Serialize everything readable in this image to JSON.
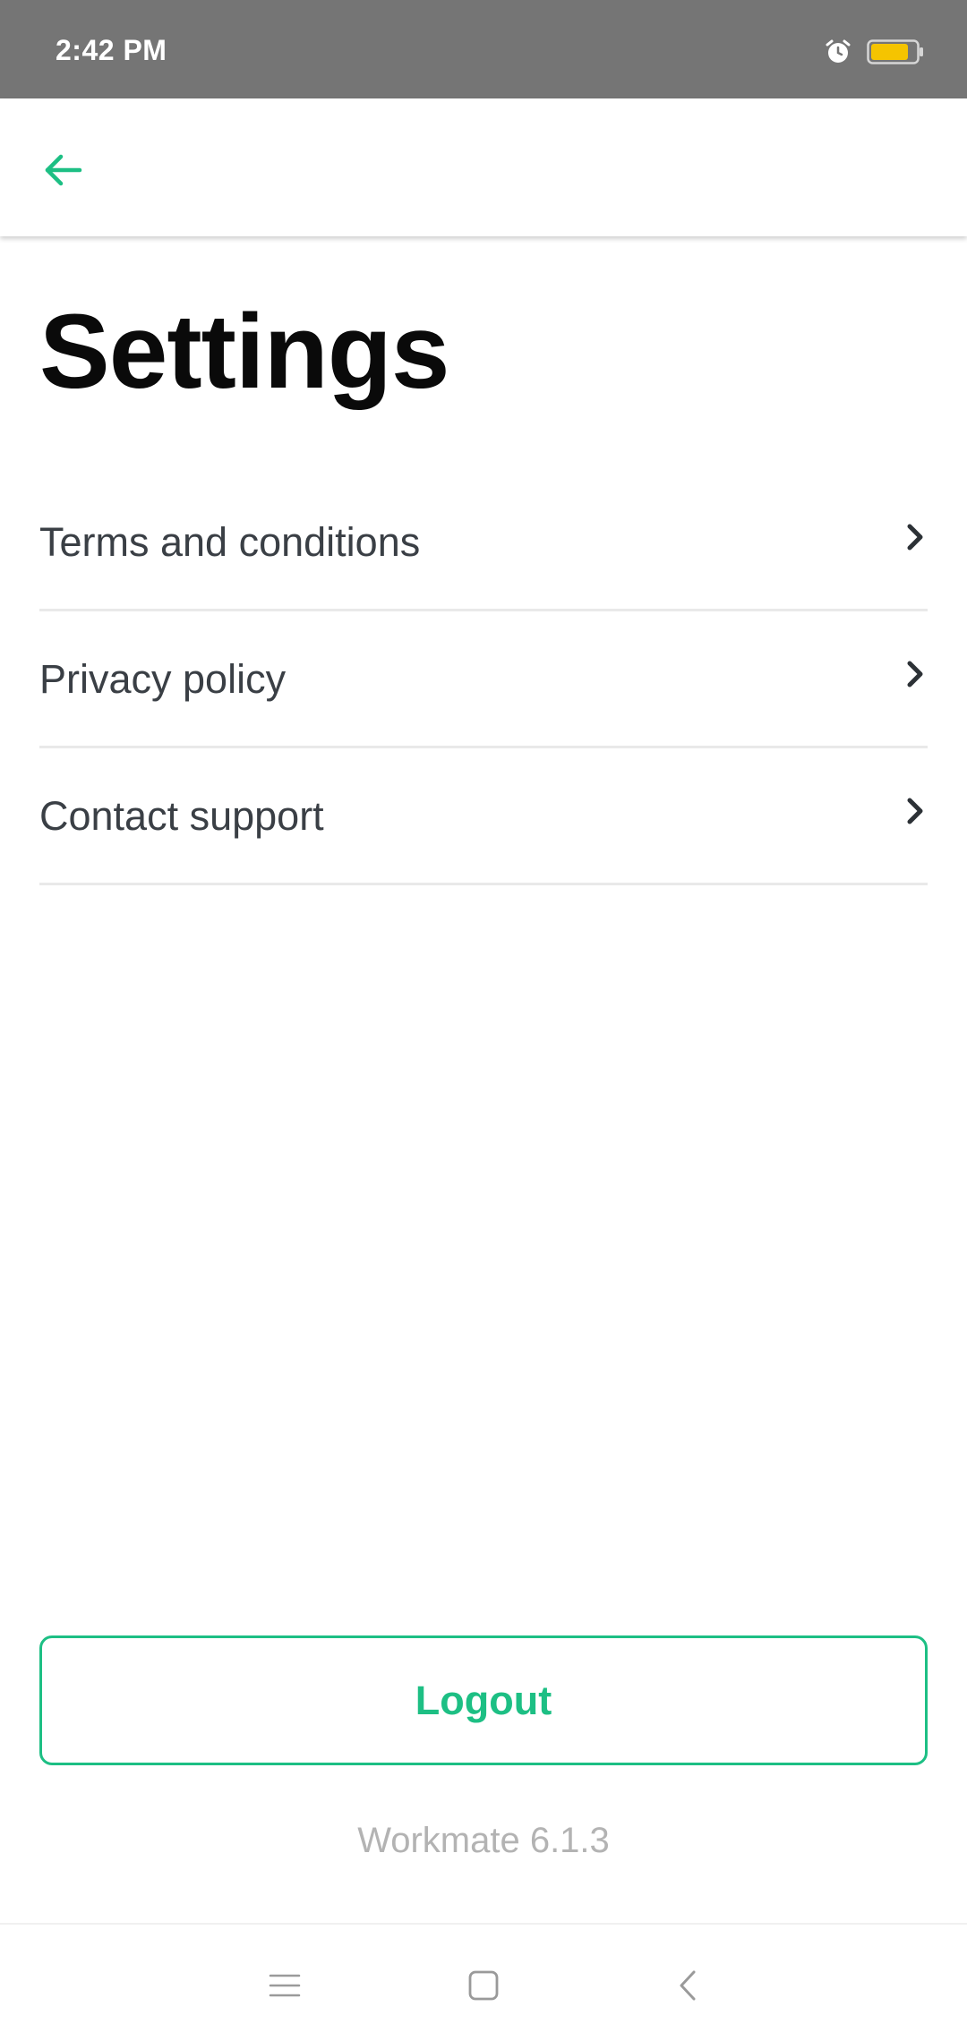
{
  "status_bar": {
    "time": "2:42 PM",
    "icons": [
      "alarm-icon",
      "battery-icon"
    ],
    "battery_color": "#f5c400"
  },
  "app_bar": {
    "back_icon": "arrow-left-icon",
    "accent_color": "#1dbf84"
  },
  "page": {
    "title": "Settings"
  },
  "menu": {
    "items": [
      {
        "label": "Terms and conditions",
        "icon": "chevron-right-icon"
      },
      {
        "label": "Privacy policy",
        "icon": "chevron-right-icon"
      },
      {
        "label": "Contact support",
        "icon": "chevron-right-icon"
      }
    ]
  },
  "logout": {
    "label": "Logout"
  },
  "footer": {
    "version": "Workmate 6.1.3"
  },
  "nav_bar": {
    "icons": [
      "menu-icon",
      "home-icon",
      "back-icon"
    ]
  }
}
